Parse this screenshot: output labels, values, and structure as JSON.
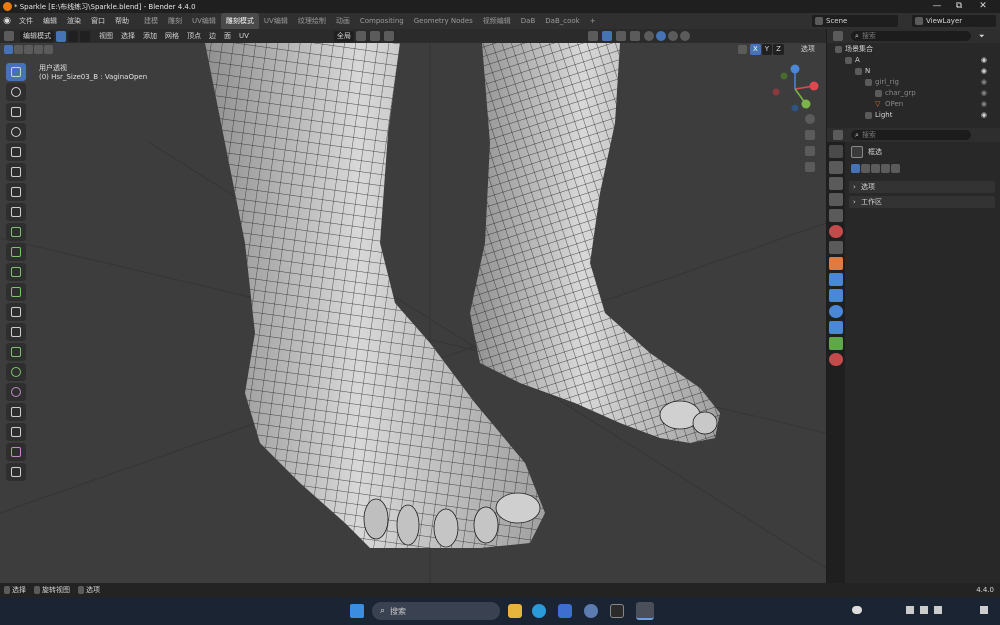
{
  "window": {
    "title": "* Sparkle [E:\\布线练习\\Sparkle.blend] - Blender 4.4.0",
    "minimize": "—",
    "maximize": "⧉",
    "close": "✕"
  },
  "menu": [
    "文件",
    "编辑",
    "渲染",
    "窗口",
    "帮助"
  ],
  "workspaces": [
    {
      "label": "建模",
      "active": false
    },
    {
      "label": "雕刻",
      "active": false
    },
    {
      "label": "UV编辑",
      "active": false
    },
    {
      "label": "雕刻模式",
      "active": true
    },
    {
      "label": "UV编辑",
      "active": false
    },
    {
      "label": "纹理绘制",
      "active": false
    },
    {
      "label": "动画",
      "active": false
    },
    {
      "label": "Compositing",
      "active": false
    },
    {
      "label": "Geometry Nodes",
      "active": false
    },
    {
      "label": "视频编辑",
      "active": false
    },
    {
      "label": "DaB",
      "active": false
    },
    {
      "label": "DaB_cook",
      "active": false
    }
  ],
  "add_workspace": "+",
  "scene": {
    "label": "Scene",
    "view_layer": "ViewLayer"
  },
  "viewport_header": {
    "mode": "编辑模式",
    "menus": [
      "视图",
      "选择",
      "添加",
      "网格",
      "顶点",
      "边",
      "面",
      "UV"
    ],
    "transform_orientation": "全局",
    "options": "选项",
    "axes": [
      "X",
      "Y",
      "Z"
    ]
  },
  "viewport": {
    "view_name": "用户透视",
    "object_info": "(0) Hsr_Size03_B : VaginaOpen"
  },
  "gizmo": {
    "x": "X",
    "y": "Y",
    "z": "Z"
  },
  "outliner": {
    "search_placeholder": "搜索",
    "rows": [
      {
        "label": "场景集合",
        "indent": 0
      },
      {
        "label": "A",
        "indent": 1
      },
      {
        "label": "N",
        "indent": 2
      },
      {
        "label": "girl_rig",
        "indent": 3
      },
      {
        "label": "char_grp",
        "indent": 4
      },
      {
        "label": "OPen",
        "indent": 4
      },
      {
        "label": "Light",
        "indent": 3
      }
    ]
  },
  "properties": {
    "search_placeholder": "搜索",
    "tool_name": "框选",
    "panels": [
      "选项",
      "工作区"
    ]
  },
  "statusbar": {
    "items": [
      "选择",
      "旋转视图",
      "选项"
    ],
    "version": "4.4.0"
  },
  "taskbar": {
    "search_placeholder": "搜索"
  },
  "colors": {
    "accent": "#4673b5",
    "viewport_bg": "#3d3d3d",
    "mesh": "#c8c8c8",
    "wire": "#1a1a1a"
  }
}
